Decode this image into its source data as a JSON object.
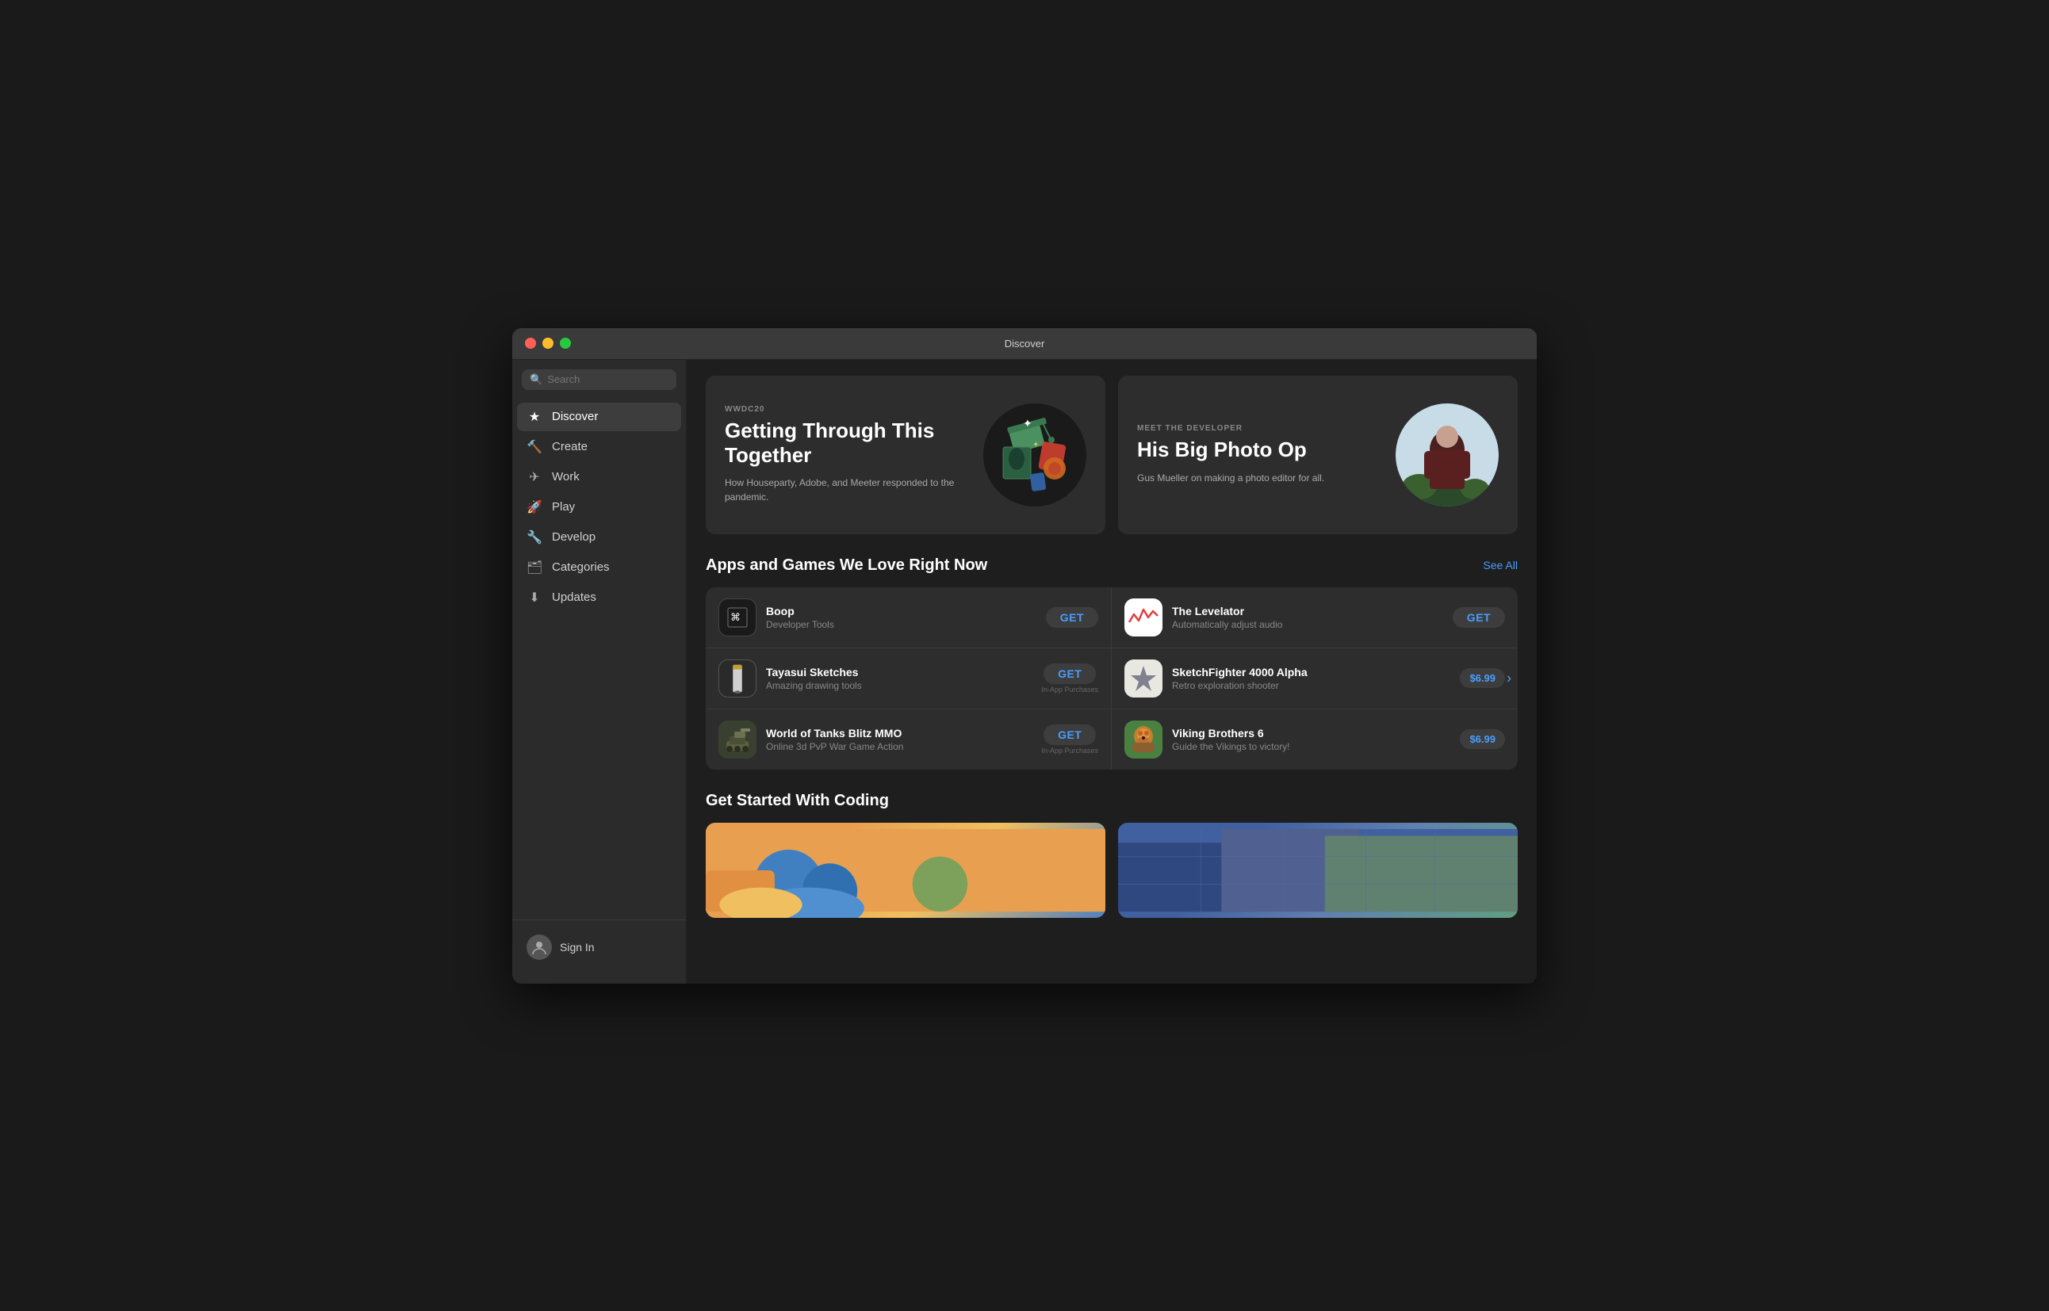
{
  "window": {
    "title": "Discover"
  },
  "titlebar": {
    "title": "Discover"
  },
  "sidebar": {
    "search": {
      "placeholder": "Search"
    },
    "nav_items": [
      {
        "id": "discover",
        "label": "Discover",
        "icon": "★",
        "active": true
      },
      {
        "id": "create",
        "label": "Create",
        "icon": "🔨"
      },
      {
        "id": "work",
        "label": "Work",
        "icon": "✈"
      },
      {
        "id": "play",
        "label": "Play",
        "icon": "🚀"
      },
      {
        "id": "develop",
        "label": "Develop",
        "icon": "🔧"
      },
      {
        "id": "categories",
        "label": "Categories",
        "icon": "🗂"
      },
      {
        "id": "updates",
        "label": "Updates",
        "icon": "⬇"
      }
    ],
    "sign_in": {
      "label": "Sign In"
    }
  },
  "hero_cards": [
    {
      "id": "wwdc",
      "subtitle": "WWDC20",
      "title": "Getting Through This Together",
      "description": "How Houseparty, Adobe, and Meeter responded to the pandemic."
    },
    {
      "id": "developer",
      "subtitle": "MEET THE DEVELOPER",
      "title": "His Big Photo Op",
      "description": "Gus Mueller on making a photo editor for all."
    }
  ],
  "apps_section": {
    "title": "Apps and Games We Love Right Now",
    "see_all_label": "See All",
    "apps": [
      {
        "id": "boop",
        "name": "Boop",
        "description": "Developer Tools",
        "action": "GET",
        "action_type": "get",
        "in_app": false,
        "icon_label": "⌘"
      },
      {
        "id": "levelator",
        "name": "The Levelator",
        "description": "Automatically adjust audio",
        "action": "GET",
        "action_type": "get",
        "in_app": false,
        "icon_label": "~"
      },
      {
        "id": "tayasui",
        "name": "Tayasui Sketches",
        "description": "Amazing drawing tools",
        "action": "GET",
        "action_type": "get",
        "in_app": true,
        "icon_label": "✏"
      },
      {
        "id": "sketchfighter",
        "name": "SketchFighter 4000 Alpha",
        "description": "Retro exploration shooter",
        "action": "$6.99",
        "action_type": "price",
        "in_app": false,
        "icon_label": "🚀",
        "has_chevron": true
      },
      {
        "id": "tanks",
        "name": "World of Tanks Blitz MMO",
        "description": "Online 3d PvP War Game Action",
        "action": "GET",
        "action_type": "get",
        "in_app": true,
        "icon_label": "🪖"
      },
      {
        "id": "viking",
        "name": "Viking Brothers 6",
        "description": "Guide the Vikings to victory!",
        "action": "$6.99",
        "action_type": "price",
        "in_app": false,
        "icon_label": "🛡"
      }
    ]
  },
  "coding_section": {
    "title": "Get Started With Coding"
  }
}
